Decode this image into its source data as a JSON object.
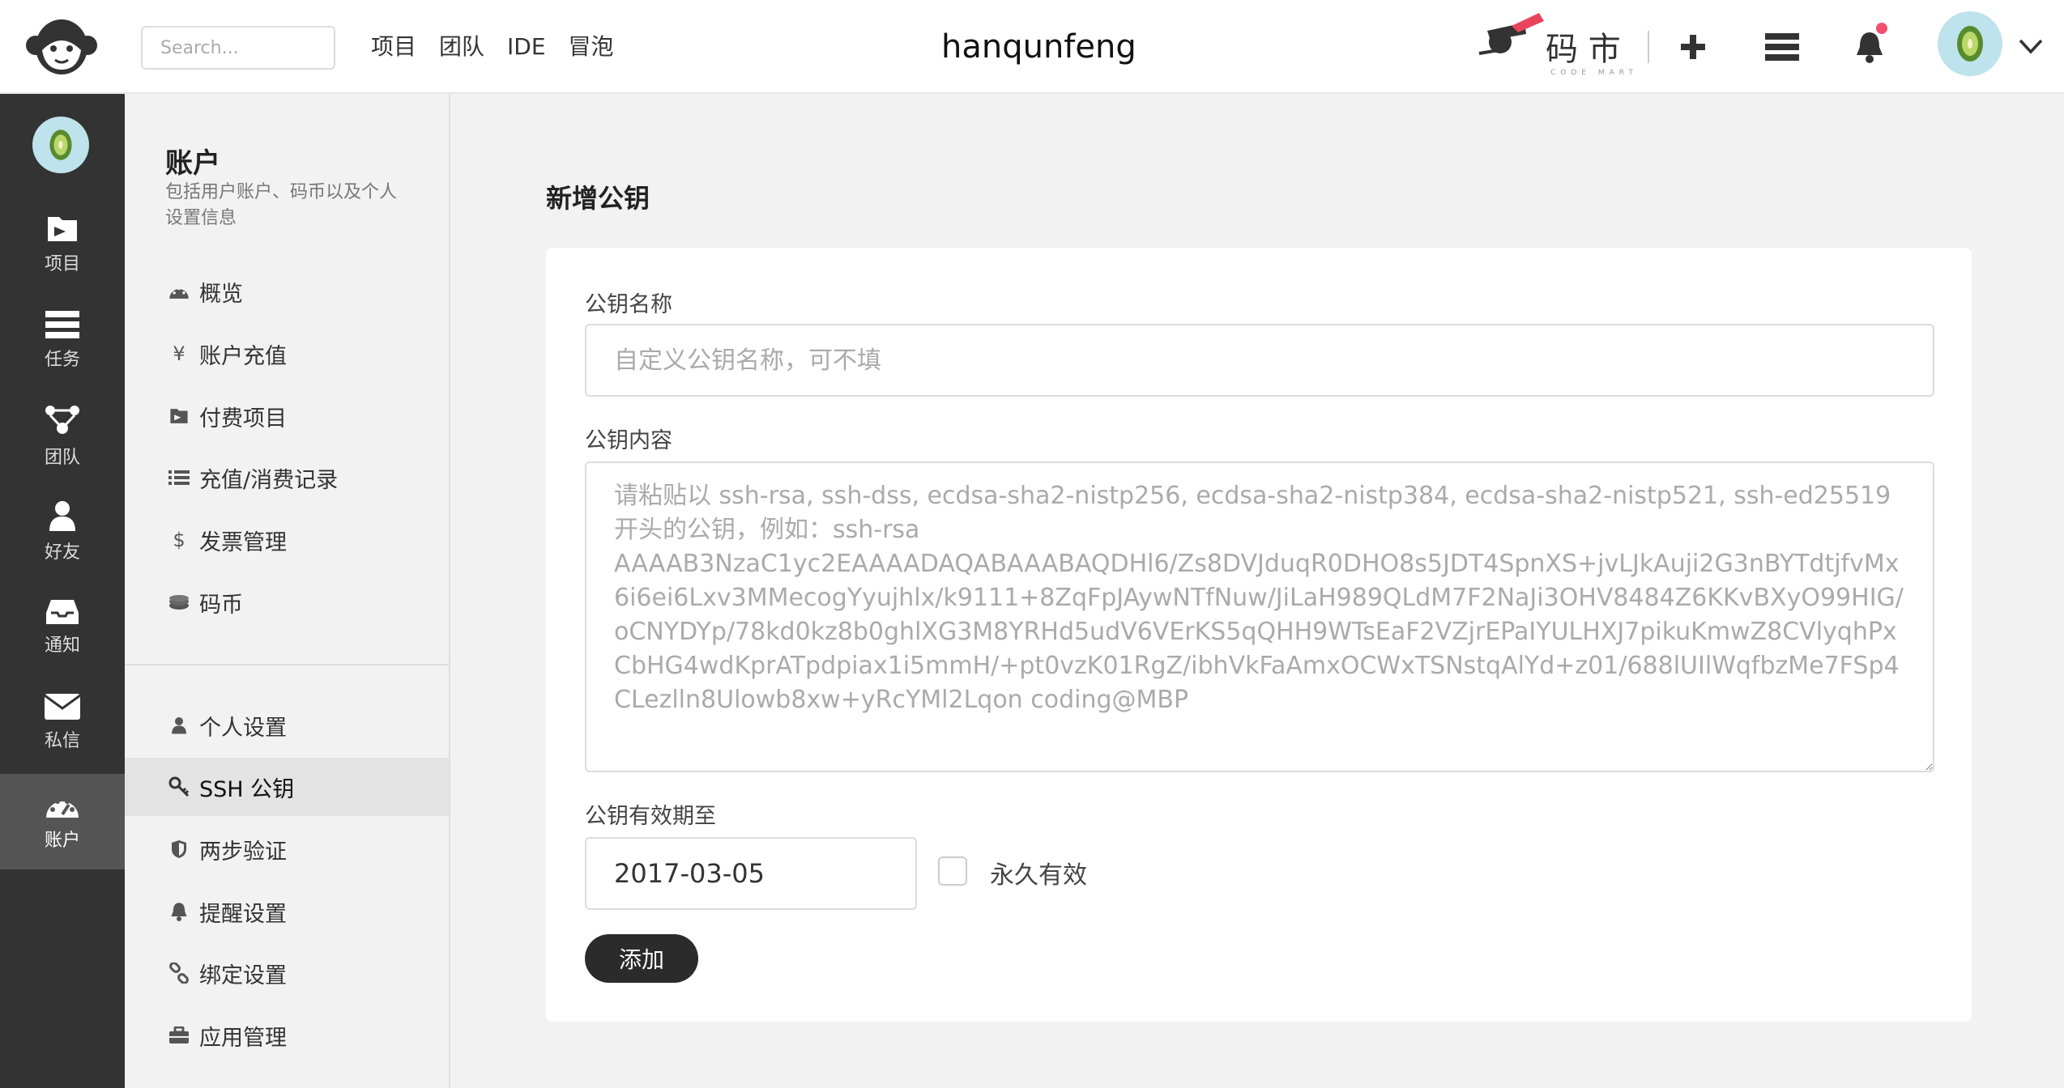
{
  "header": {
    "search_placeholder": "Search...",
    "nav": [
      "项目",
      "团队",
      "IDE",
      "冒泡"
    ],
    "username": "hanqunfeng",
    "brand_text": "码 市",
    "brand_sub": "CODE MART"
  },
  "darkbar": {
    "items": [
      "项目",
      "任务",
      "团队",
      "好友",
      "通知",
      "私信",
      "账户"
    ]
  },
  "menu": {
    "title": "账户",
    "description": "包括用户账户、码币以及个人设置信息",
    "group1": [
      "概览",
      "账户充值",
      "付费项目",
      "充值/消费记录",
      "发票管理",
      "码币"
    ],
    "group2": [
      "个人设置",
      "SSH 公钥",
      "两步验证",
      "提醒设置",
      "绑定设置",
      "应用管理"
    ]
  },
  "form": {
    "page_title": "新增公钥",
    "name_label": "公钥名称",
    "name_placeholder": "自定义公钥名称，可不填",
    "content_label": "公钥内容",
    "content_placeholder": "请粘贴以 ssh-rsa, ssh-dss, ecdsa-sha2-nistp256, ecdsa-sha2-nistp384, ecdsa-sha2-nistp521, ssh-ed25519 开头的公钥，例如：ssh-rsa AAAAB3NzaC1yc2EAAAADAQABAAABAQDHl6/Zs8DVJduqR0DHO8s5JDT4SpnXS+jvLJkAuji2G3nBYTdtjfvMx6i6ei6Lxv3MMecogYyujhlx/k9111+8ZqFpJAywNTfNuw/JiLaH989QLdM7F2NaJi3OHV8484Z6KKvBXyO99HIG/oCNYDYp/78kd0kz8b0ghlXG3M8YRHd5udV6VErKS5qQHH9WTsEaF2VZjrEPaIYULHXJ7pikuKmwZ8CVlyqhPxCbHG4wdKprATpdpiax1i5mmH/+pt0vzK01RgZ/ibhVkFaAmxOCWxTSNstqAlYd+z01/688lUIlWqfbzMe7FSp4CLezlln8Ulowb8xw+yRcYMl2Lqon coding@MBP",
    "expire_label": "公钥有效期至",
    "expire_value": "2017-03-05",
    "forever_label": "永久有效",
    "add_button": "添加"
  },
  "colors": {
    "dark_sidebar": "#333333",
    "active_dark": "#555555",
    "notify_dot": "#f0506e",
    "button": "#2b2b2b"
  }
}
